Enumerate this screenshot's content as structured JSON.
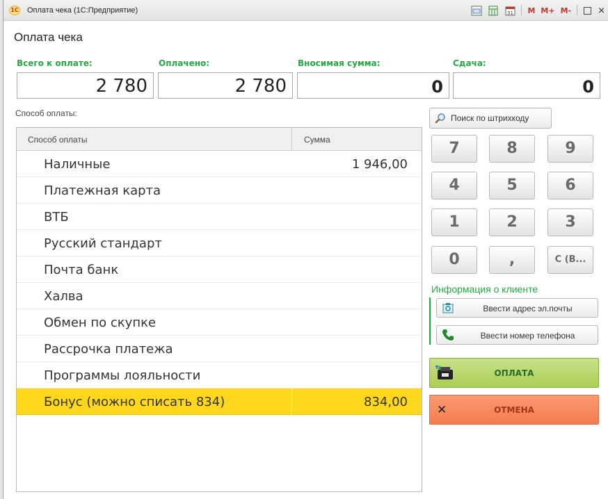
{
  "window": {
    "title": "Оплата чека  (1С:Предприятие)",
    "logo_text": "1С",
    "toolbar": {
      "m": "M",
      "m_plus": "M+",
      "m_minus": "M-",
      "close": "×"
    }
  },
  "form": {
    "title": "Оплата чека",
    "totals": {
      "total_label": "Всего к оплате:",
      "total_value": "2 780",
      "paid_label": "Оплачено:",
      "paid_value": "2 780",
      "deposit_label": "Вносимая сумма:",
      "deposit_value": "0",
      "change_label": "Сдача:",
      "change_value": "0"
    },
    "payment_method_label": "Способ оплаты:",
    "table": {
      "col_name": "Способ оплаты",
      "col_sum": "Сумма",
      "rows": [
        {
          "name": "Наличные",
          "sum": "1 946,00"
        },
        {
          "name": "Платежная карта",
          "sum": ""
        },
        {
          "name": "ВТБ",
          "sum": ""
        },
        {
          "name": "Русский стандарт",
          "sum": ""
        },
        {
          "name": "Почта банк",
          "sum": ""
        },
        {
          "name": "Халва",
          "sum": ""
        },
        {
          "name": "Обмен по скупке",
          "sum": ""
        },
        {
          "name": "Рассрочка платежа",
          "sum": ""
        },
        {
          "name": "Программы лояльности",
          "sum": ""
        },
        {
          "name": "Бонус (можно списать 834)",
          "sum": "834,00"
        }
      ],
      "selected_index": 9
    },
    "barcode_search": "Поиск по штрихкоду",
    "keypad": [
      "7",
      "8",
      "9",
      "4",
      "5",
      "6",
      "1",
      "2",
      "3",
      "0",
      ",",
      "С (В..."
    ],
    "client_info": {
      "title": "Информация о клиенте",
      "email_button": "Ввести адрес эл.почты",
      "phone_button": "Ввести номер телефона"
    },
    "pay_button": "ОПЛАТА",
    "cancel_button": "ОТМЕНА",
    "colors": {
      "accent_green": "#27a744",
      "selected_row": "#ffd71c",
      "pay_green": "#aacf55",
      "cancel_orange": "#f57d4f"
    }
  }
}
